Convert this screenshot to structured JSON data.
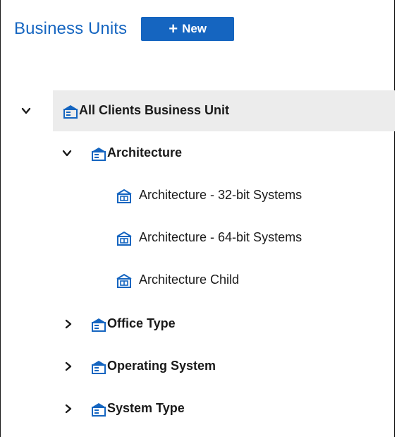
{
  "header": {
    "title": "Business Units",
    "new_button_label": "New"
  },
  "colors": {
    "accent": "#1565c0",
    "selected_row": "#ececec"
  },
  "tree": {
    "root": {
      "label": "All Clients Business Unit",
      "expanded": true,
      "selected": true,
      "icon": "business-unit-group-icon",
      "children": [
        {
          "label": "Architecture",
          "expanded": true,
          "icon": "business-unit-group-icon",
          "children": [
            {
              "label": "Architecture - 32-bit Systems",
              "icon": "business-unit-leaf-icon"
            },
            {
              "label": "Architecture - 64-bit Systems",
              "icon": "business-unit-leaf-icon"
            },
            {
              "label": "Architecture Child",
              "icon": "business-unit-leaf-icon"
            }
          ]
        },
        {
          "label": "Office Type",
          "expanded": false,
          "icon": "business-unit-group-icon"
        },
        {
          "label": "Operating System",
          "expanded": false,
          "icon": "business-unit-group-icon"
        },
        {
          "label": "System Type",
          "expanded": false,
          "icon": "business-unit-group-icon"
        }
      ]
    }
  }
}
